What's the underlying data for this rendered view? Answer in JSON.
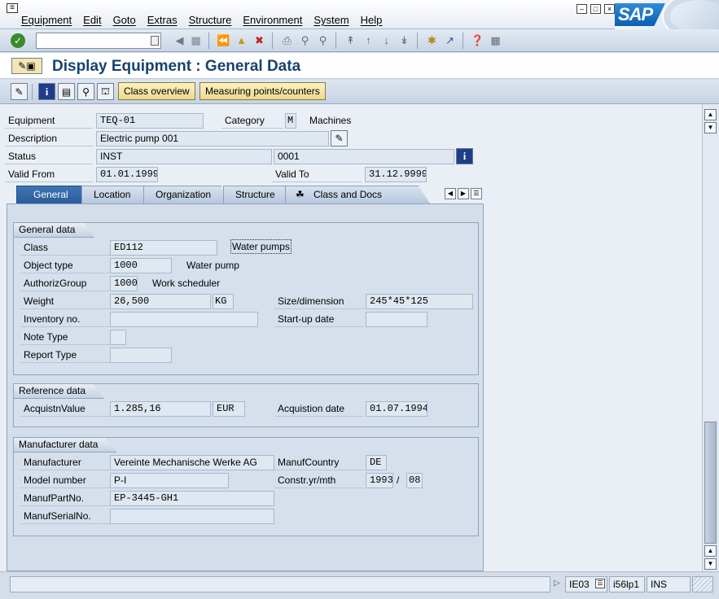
{
  "menu": {
    "items": [
      "Equipment",
      "Edit",
      "Goto",
      "Extras",
      "Structure",
      "Environment",
      "System",
      "Help"
    ]
  },
  "brand": {
    "logo_text": "SAP"
  },
  "title": {
    "text": "Display Equipment : General Data"
  },
  "app_toolbar": {
    "class_overview": "Class overview",
    "measuring_points": "Measuring points/counters"
  },
  "header": {
    "equipment_label": "Equipment",
    "equipment_value": "TEQ-01",
    "category_label": "Category",
    "category_value": "M",
    "category_text": "Machines",
    "description_label": "Description",
    "description_value": "Electric pump 001",
    "status_label": "Status",
    "status_value": "INST",
    "status_value2": "0001",
    "valid_from_label": "Valid From",
    "valid_from_value": "01.01.1999",
    "valid_to_label": "Valid To",
    "valid_to_value": "31.12.9999"
  },
  "tabs": [
    "General",
    "Location",
    "Organization",
    "Structure",
    "Class and Docs"
  ],
  "general_data": {
    "title": "General data",
    "class_label": "Class",
    "class_value": "ED112",
    "class_text": "Water pumps",
    "object_type_label": "Object type",
    "object_type_value": "1000",
    "object_type_text": "Water pump",
    "authoriz_label": "AuthorizGroup",
    "authoriz_value": "1000",
    "authoriz_text": "Work scheduler",
    "weight_label": "Weight",
    "weight_value": "26,500",
    "weight_unit": "KG",
    "size_label": "Size/dimension",
    "size_value": "245*45*125",
    "inventory_label": "Inventory no.",
    "inventory_value": "",
    "startup_label": "Start-up date",
    "startup_value": "",
    "note_label": "Note Type",
    "note_value": "",
    "report_label": "Report Type",
    "report_value": ""
  },
  "reference_data": {
    "title": "Reference data",
    "acq_value_label": "AcquistnValue",
    "acq_value": "1.285,16",
    "acq_currency": "EUR",
    "acq_date_label": "Acquistion date",
    "acq_date": "01.07.1994"
  },
  "manufacturer_data": {
    "title": "Manufacturer data",
    "manufacturer_label": "Manufacturer",
    "manufacturer_value": "Vereinte Mechanische Werke AG",
    "country_label": "ManufCountry",
    "country_value": "DE",
    "model_label": "Model number",
    "model_value": "P-I",
    "constr_label": "Constr.yr/mth",
    "constr_year": "1993",
    "constr_sep": "/",
    "constr_month": "08",
    "partno_label": "ManufPartNo.",
    "partno_value": "EP-3445-GH1",
    "serial_label": "ManufSerialNo.",
    "serial_value": ""
  },
  "status_bar": {
    "transaction": "IE03",
    "server": "i56lp1",
    "mode": "INS"
  },
  "icons": {
    "menu": "window-menu-icon",
    "enter": "check-icon",
    "info": "info-icon"
  }
}
